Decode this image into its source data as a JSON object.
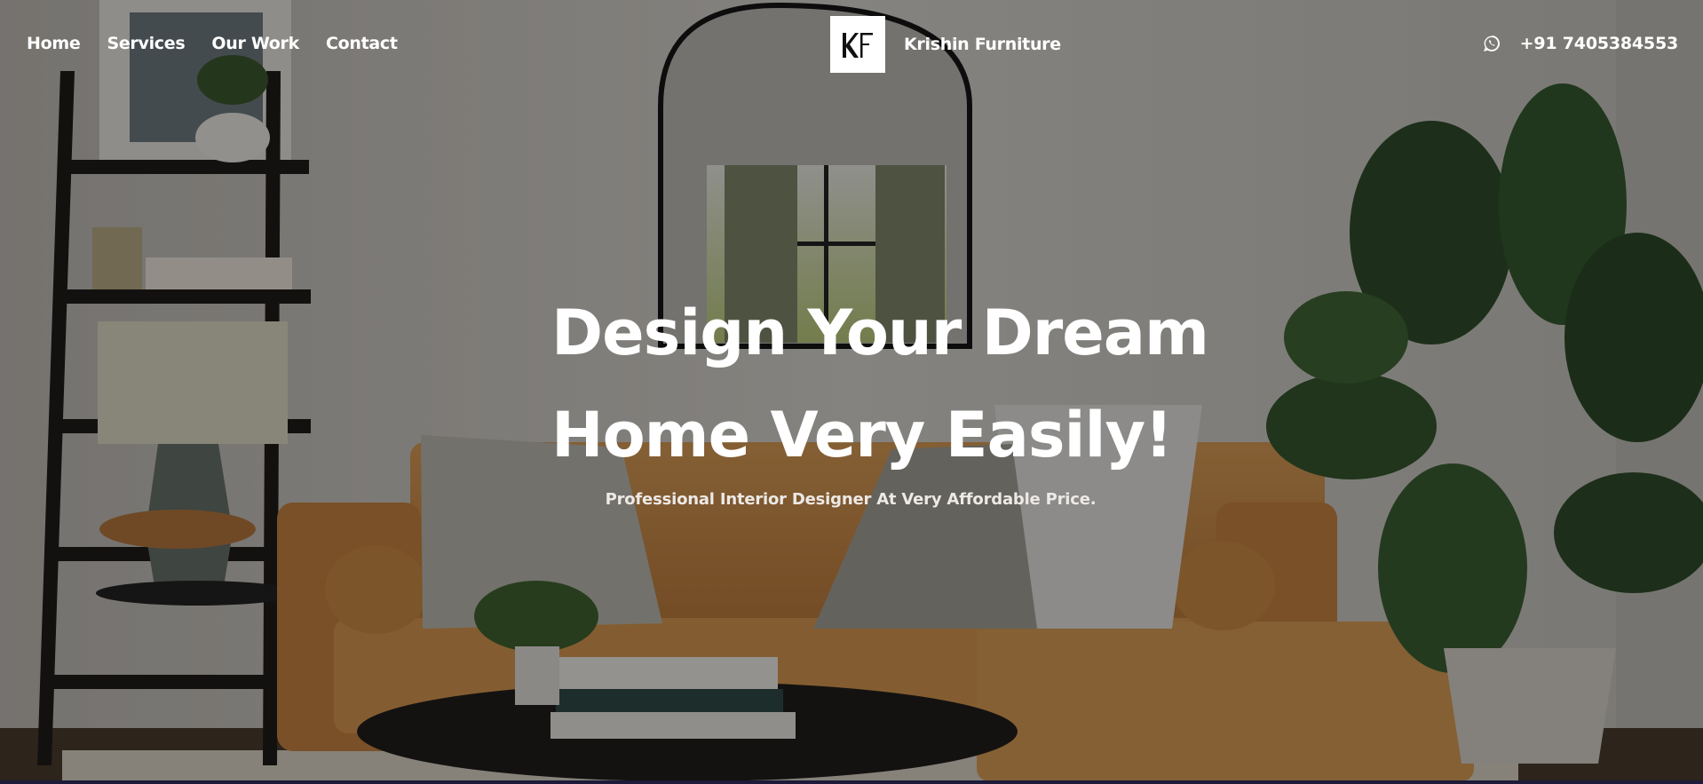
{
  "nav": {
    "links": [
      "Home",
      "Services",
      "Our Work",
      "Contact"
    ]
  },
  "brand": {
    "name": "Krishin Furniture",
    "logo_letters": "KF"
  },
  "contact": {
    "icon": "whatsapp-icon",
    "phone": "+91 7405384553"
  },
  "hero": {
    "headline_line1": "Design Your Dream",
    "headline_line2": "Home Very Easily!",
    "subtitle": "Professional Interior Designer At Very Affordable Price."
  },
  "colors": {
    "text": "#ffffff",
    "overlay": "#000000",
    "sofa": "#c98a45",
    "wall": "#d8d5cf",
    "plant": "#2f4d2a"
  }
}
